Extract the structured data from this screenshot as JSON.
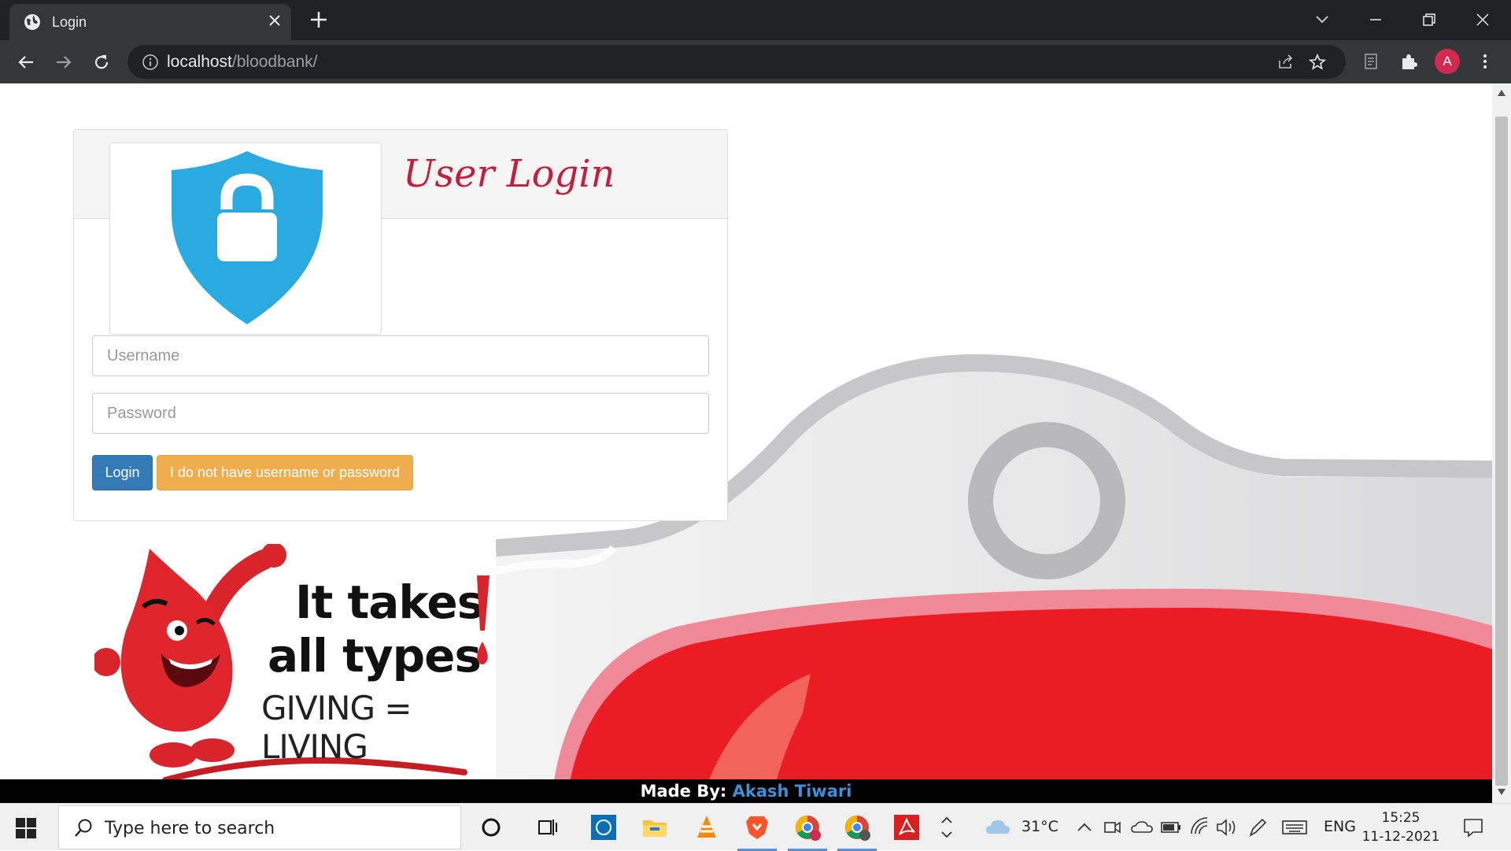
{
  "browser": {
    "tab_title": "Login",
    "url_host": "localhost",
    "url_path": "/bloodbank/",
    "profile_initial": "A"
  },
  "login": {
    "title": "User Login",
    "username_placeholder": "Username",
    "password_placeholder": "Password",
    "login_button": "Login",
    "forgot_button": "I do not have username or password"
  },
  "poster": {
    "line1": "It takes",
    "line2": "all types",
    "line3": "GIVING = LIVING"
  },
  "footer": {
    "prefix": "Made By:",
    "author": "Akash Tiwari"
  },
  "taskbar": {
    "search_placeholder": "Type here to search",
    "temperature": "31°C",
    "language": "ENG",
    "time": "15:25",
    "date": "11-12-2021"
  },
  "colors": {
    "title_red": "#c41e3a",
    "login_blue": "#337ab7",
    "forgot_orange": "#f0ad4e",
    "shield_blue": "#29abe2",
    "footer_author_blue": "#3f8fd8"
  }
}
